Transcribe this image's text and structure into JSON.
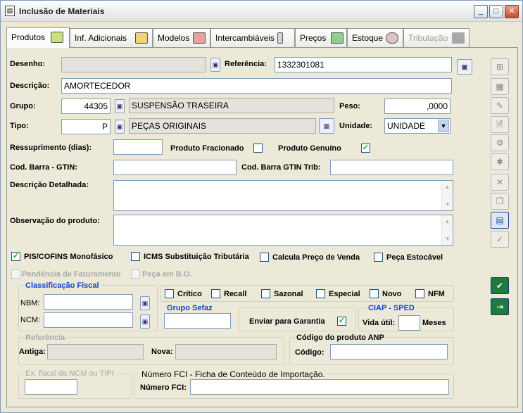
{
  "window": {
    "title": "Inclusão de Materiais",
    "minimize": "_",
    "maximize": "□",
    "close": "✕"
  },
  "tabs": [
    {
      "label": "Produtos"
    },
    {
      "label": "Inf. Adicionais"
    },
    {
      "label": "Modelos"
    },
    {
      "label": "Intercambiáveis"
    },
    {
      "label": "Preços"
    },
    {
      "label": "Estoque"
    },
    {
      "label": "Tributação"
    }
  ],
  "form": {
    "desenho_label": "Desenho:",
    "desenho_value": "",
    "referencia_label": "Referência:",
    "referencia_value": "1332301081",
    "descricao_label": "Descrição:",
    "descricao_value": "AMORTECEDOR",
    "grupo_label": "Grupo:",
    "grupo_code": "44305",
    "grupo_name": "SUSPENSÃO TRASEIRA",
    "peso_label": "Peso:",
    "peso_value": ",0000",
    "tipo_label": "Tipo:",
    "tipo_code": "P",
    "tipo_name": "PEÇAS ORIGINAIS",
    "unidade_label": "Unidade:",
    "unidade_value": "UNIDADE",
    "ressuprimento_label": "Ressuprimento (dias):",
    "ressuprimento_value": "",
    "fracionado_label": "Produto Fracionado",
    "genuino_label": "Produto Genuíno",
    "gtin_label": "Cod. Barra - GTIN:",
    "gtin_trib_label": "Cod. Barra GTIN Trib:",
    "desc_detalhada_label": "Descrição Detalhada:",
    "observacao_label": "Observação do produto:",
    "pis_label": "PIS/COFINS Monofásico",
    "icms_label": "ICMS Substituição Tributária",
    "calcula_label": "Calcula Preço de Venda",
    "estocavel_label": "Peça Estocável",
    "pendencia_label": "Pendência de Faturamento",
    "bo_label": "Peça em B.O."
  },
  "classificacao": {
    "title": "Classificação Fiscal",
    "nbm_label": "NBM:",
    "ncm_label": "NCM:",
    "critico": "Crítico",
    "recall": "Recall",
    "sazonal": "Sazonal",
    "especial": "Especial",
    "novo": "Novo",
    "nfm": "NFM",
    "grupo_sefaz": "Grupo Sefaz",
    "garantia_label": "Enviar para Garantia",
    "ciap_title": "CIAP - SPED",
    "vida_label": "Vida útil:",
    "meses": "Meses"
  },
  "referencia_group": {
    "title": "Referência",
    "antiga_label": "Antiga:",
    "nova_label": "Nova:"
  },
  "anp": {
    "title": "Código do produto ANP",
    "codigo_label": "Código:"
  },
  "ex_fiscal": {
    "title": "Ex. fiscal da NCM ou TIPI"
  },
  "fci": {
    "title": "Número  FCI - Ficha de Conteúdo de Importação.",
    "label": "Número FCI:"
  },
  "checks": {
    "genuino": true,
    "pis": true,
    "garantia": true
  },
  "icons": {
    "lookup": "magnifier-icon",
    "camera": "camera-icon"
  }
}
